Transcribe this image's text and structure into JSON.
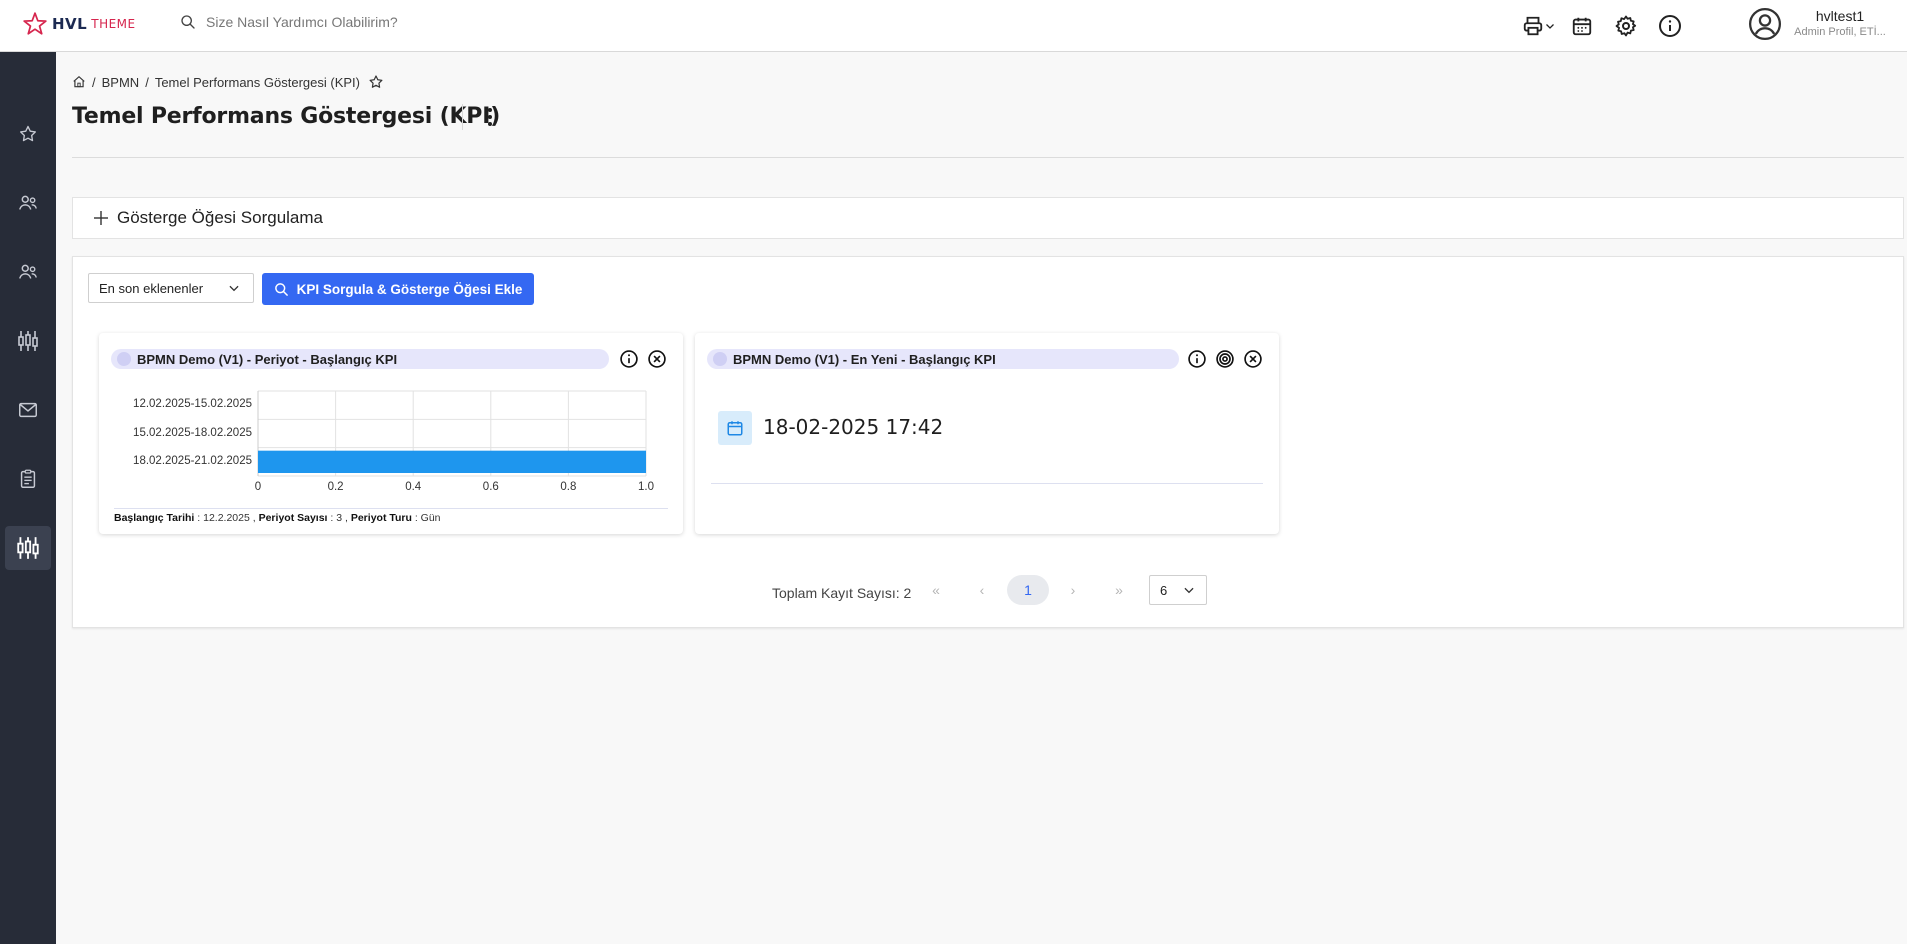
{
  "brand": {
    "name_bold": "HVL",
    "name_light": "THEME"
  },
  "search": {
    "placeholder": "Size Nasıl Yardımcı Olabilirim?"
  },
  "user": {
    "name": "hvltest1",
    "role": "Admin Profil, ETİ..."
  },
  "breadcrumb": {
    "items": [
      "BPMN",
      "Temel Performans Göstergesi (KPI)"
    ]
  },
  "page": {
    "title": "Temel Performans Göstergesi (KPI)"
  },
  "query_panel": {
    "label": "Gösterge Öğesi Sorgulama"
  },
  "toolbar": {
    "sort_select": "En son eklenenler",
    "query_button": "KPI Sorgula & Gösterge Öğesi Ekle"
  },
  "cards": [
    {
      "title": "BPMN Demo (V1) - Periyot - Başlangıç KPI",
      "footer": {
        "start_label": "Başlangıç Tarihi",
        "start_value": "12.2.2025",
        "count_label": "Periyot Sayısı",
        "count_value": "3",
        "type_label": "Periyot Turu",
        "type_value": "Gün"
      }
    },
    {
      "title": "BPMN Demo (V1) - En Yeni - Başlangıç KPI",
      "value": "18-02-2025 17:42"
    }
  ],
  "chart_data": {
    "type": "bar",
    "orientation": "horizontal",
    "categories": [
      "12.02.2025-15.02.2025",
      "15.02.2025-18.02.2025",
      "18.02.2025-21.02.2025"
    ],
    "values": [
      0,
      0,
      1.0
    ],
    "xlim": [
      0,
      1.0
    ],
    "xticks": [
      "0",
      "0.2",
      "0.4",
      "0.6",
      "0.8",
      "1.0"
    ],
    "grid": true,
    "bar_color": "#1e96ee"
  },
  "pagination": {
    "total_label": "Toplam Kayıt Sayısı: 2",
    "first": "«",
    "prev": "‹",
    "current": "1",
    "next": "›",
    "last": "»",
    "page_size": "6"
  },
  "colors": {
    "primary": "#3468f2",
    "sidebar": "#272c38",
    "brand_red": "#d6264e"
  },
  "icons": {
    "top": [
      "printer-icon",
      "calendar-icon",
      "gear-icon",
      "info-icon",
      "user-circle-icon"
    ],
    "sidebar": [
      "star-icon",
      "users-icon",
      "users-icon",
      "kpi-icon",
      "mail-icon",
      "clipboard-icon",
      "kpi-icon"
    ]
  }
}
